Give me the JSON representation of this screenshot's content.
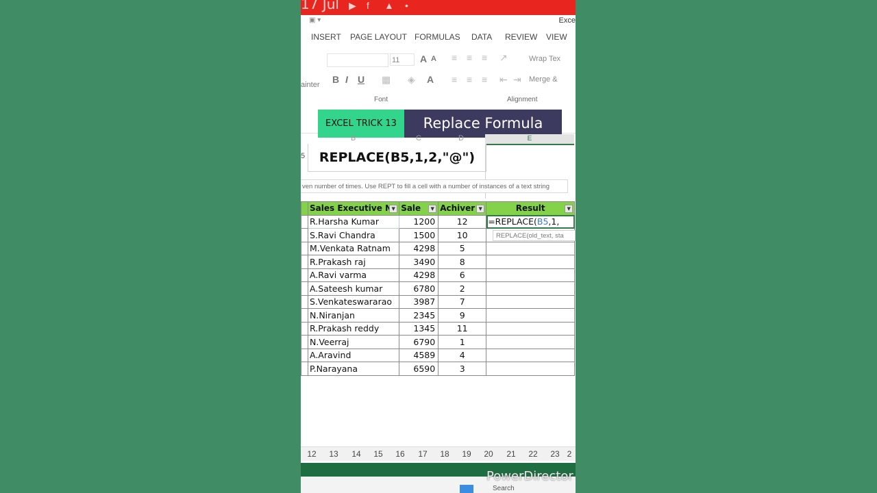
{
  "status_bar": {
    "date": "17 Jul"
  },
  "window": {
    "app_title": "Exce"
  },
  "ribbon": {
    "tabs": [
      "INSERT",
      "PAGE LAYOUT",
      "FORMULAS",
      "DATA",
      "REVIEW",
      "VIEW"
    ],
    "painter_label": "ainter",
    "font_size": "11",
    "font_group_label": "Font",
    "alignment_group_label": "Alignment",
    "wrap_text_label": "Wrap Tex",
    "merge_label": "Merge &"
  },
  "overlay": {
    "trick_label": "EXCEL TRICK 13",
    "title": "Replace Formula"
  },
  "column_headers": [
    "B",
    "C",
    "D",
    "E"
  ],
  "left_row_label": "5",
  "formula_display": "REPLACE(B5,1,2,\"@\")",
  "function_tooltip": "ven number of times. Use REPT to fill a cell with a number of instances of a text string",
  "table": {
    "headers": [
      "Sales Executive Na",
      "Sale",
      "Achiver",
      "Result"
    ],
    "rows": [
      {
        "name": "R.Harsha Kumar",
        "sale": "1200",
        "ach": "12"
      },
      {
        "name": "S.Ravi Chandra",
        "sale": "1500",
        "ach": "10"
      },
      {
        "name": "M.Venkata Ratnam",
        "sale": "4298",
        "ach": "5"
      },
      {
        "name": "R.Prakash raj",
        "sale": "3490",
        "ach": "8"
      },
      {
        "name": "A.Ravi varma",
        "sale": "4298",
        "ach": "6"
      },
      {
        "name": "A.Sateesh kumar",
        "sale": "6780",
        "ach": "2"
      },
      {
        "name": "S.Venkateswararao",
        "sale": "3987",
        "ach": "7"
      },
      {
        "name": "N.Niranjan",
        "sale": "2345",
        "ach": "9"
      },
      {
        "name": "R.Prakash reddy",
        "sale": "1345",
        "ach": "11"
      },
      {
        "name": "N.Veerraj",
        "sale": "6790",
        "ach": "1"
      },
      {
        "name": "A.Aravind",
        "sale": "4589",
        "ach": "4"
      },
      {
        "name": "P.Narayana",
        "sale": "6590",
        "ach": "3"
      }
    ],
    "editing_formula_prefix": "=REPLACE(",
    "editing_formula_ref": "B5",
    "editing_formula_suffix": ",1,",
    "argument_hint": "REPLACE(old_text, sta"
  },
  "row_numbers": [
    "12",
    "13",
    "14",
    "15",
    "16",
    "17",
    "18",
    "19",
    "20",
    "21",
    "22",
    "23",
    "2"
  ],
  "taskbar": {
    "search_label": "Search"
  },
  "watermark": "PowerDirector",
  "colors": {
    "background": "#3f8c65",
    "header_green": "#83d24a",
    "trick_green": "#33d58c",
    "title_purple": "#3c3a5e",
    "top_red": "#e8261f"
  }
}
